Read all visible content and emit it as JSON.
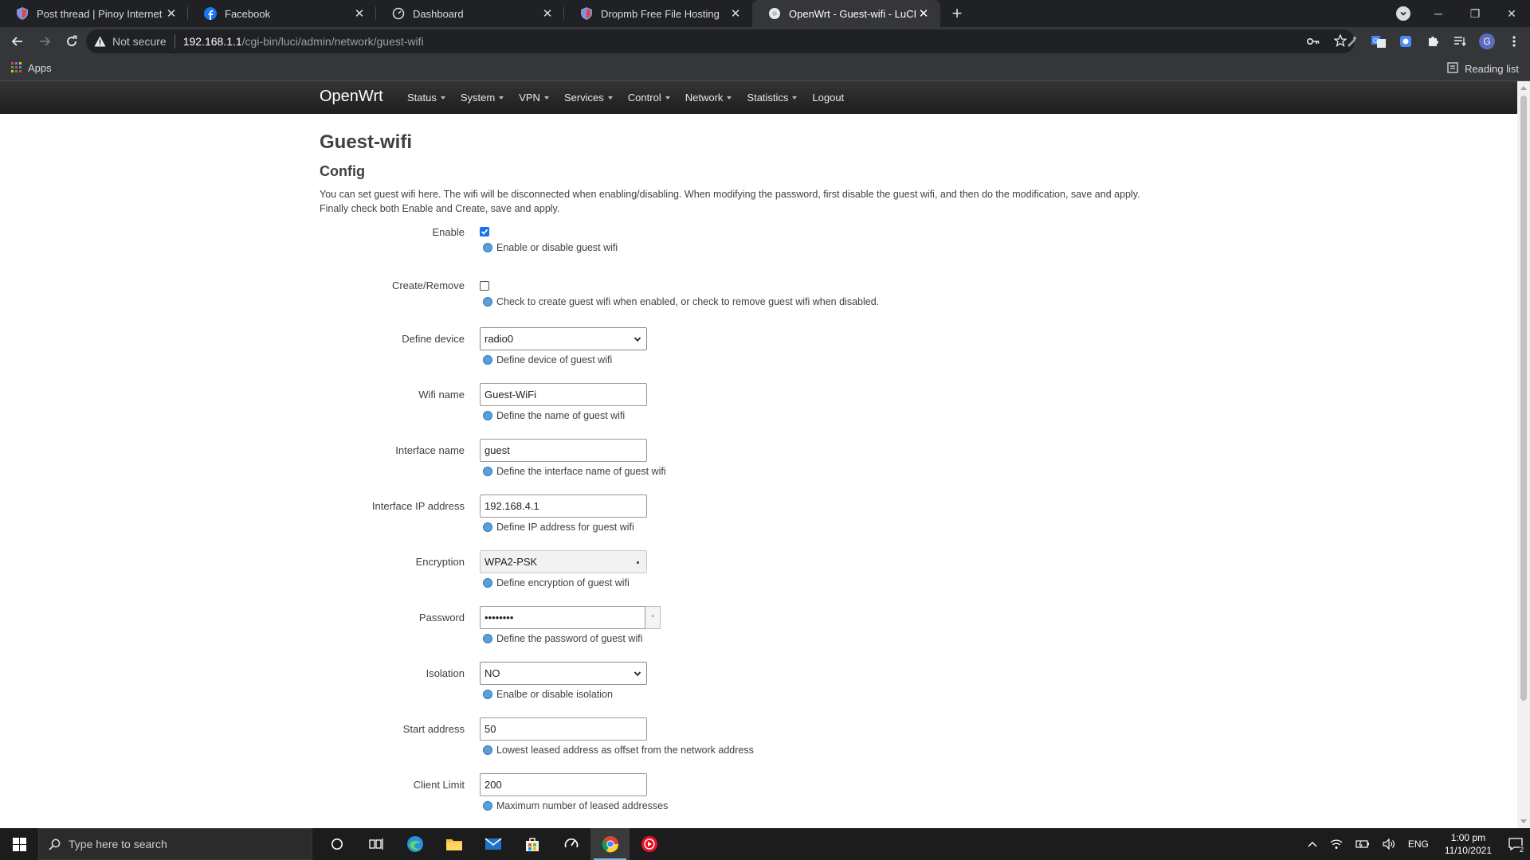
{
  "browser": {
    "tabs": [
      {
        "title": "Post thread | Pinoy Internet and",
        "icon": "shield-favicon",
        "active": false
      },
      {
        "title": "Facebook",
        "icon": "facebook-favicon",
        "active": false
      },
      {
        "title": "Dashboard",
        "icon": "dashboard-favicon",
        "active": false
      },
      {
        "title": "Dropmb Free File Hosting",
        "icon": "shield-favicon",
        "active": false
      },
      {
        "title": "OpenWrt - Guest-wifi - LuCI",
        "icon": "globe-favicon",
        "active": true
      }
    ],
    "not_secure_label": "Not secure",
    "url_host": "192.168.1.1",
    "url_path": "/cgi-bin/luci/admin/network/guest-wifi",
    "bookmarks": {
      "apps_label": "Apps",
      "reading_list_label": "Reading list"
    },
    "profile_initial": "G",
    "accent_color": "#1a73e8"
  },
  "luci": {
    "brand": "OpenWrt",
    "menu": [
      "Status",
      "System",
      "VPN",
      "Services",
      "Control",
      "Network",
      "Statistics"
    ],
    "logout": "Logout",
    "page_title": "Guest-wifi",
    "section_title": "Config",
    "description_line1": "You can set guest wifi here. The wifi will be disconnected when enabling/disabling. When modifying the password, first disable the guest wifi, and then do the modification, save and apply.",
    "description_line2": "Finally check both Enable and Create, save and apply.",
    "fields": {
      "enable": {
        "label": "Enable",
        "checked": true,
        "help": "Enable or disable guest wifi"
      },
      "create": {
        "label": "Create/Remove",
        "checked": false,
        "help": "Check to create guest wifi when enabled, or check to remove guest wifi when disabled."
      },
      "device": {
        "label": "Define device",
        "value": "radio0",
        "help": "Define device of guest wifi"
      },
      "wifi_name": {
        "label": "Wifi name",
        "value": "Guest-WiFi",
        "help": "Define the name of guest wifi"
      },
      "iface_name": {
        "label": "Interface name",
        "value": "guest",
        "help": "Define the interface name of guest wifi"
      },
      "iface_ip": {
        "label": "Interface IP address",
        "value": "192.168.4.1",
        "help": "Define IP address for guest wifi"
      },
      "encryption": {
        "label": "Encryption",
        "value": "WPA2-PSK",
        "help": "Define encryption of guest wifi"
      },
      "password": {
        "label": "Password",
        "value": "••••••••",
        "help": "Define the password of guest wifi"
      },
      "isolation": {
        "label": "Isolation",
        "value": "NO",
        "help": "Enalbe or disable isolation"
      },
      "start": {
        "label": "Start address",
        "value": "50",
        "help": "Lowest leased address as offset from the network address"
      },
      "limit": {
        "label": "Client Limit",
        "value": "200",
        "help": "Maximum number of leased addresses"
      }
    }
  },
  "taskbar": {
    "search_placeholder": "Type here to search",
    "language": "ENG",
    "time": "1:00 pm",
    "date": "11/10/2021",
    "notification_count": "2"
  }
}
